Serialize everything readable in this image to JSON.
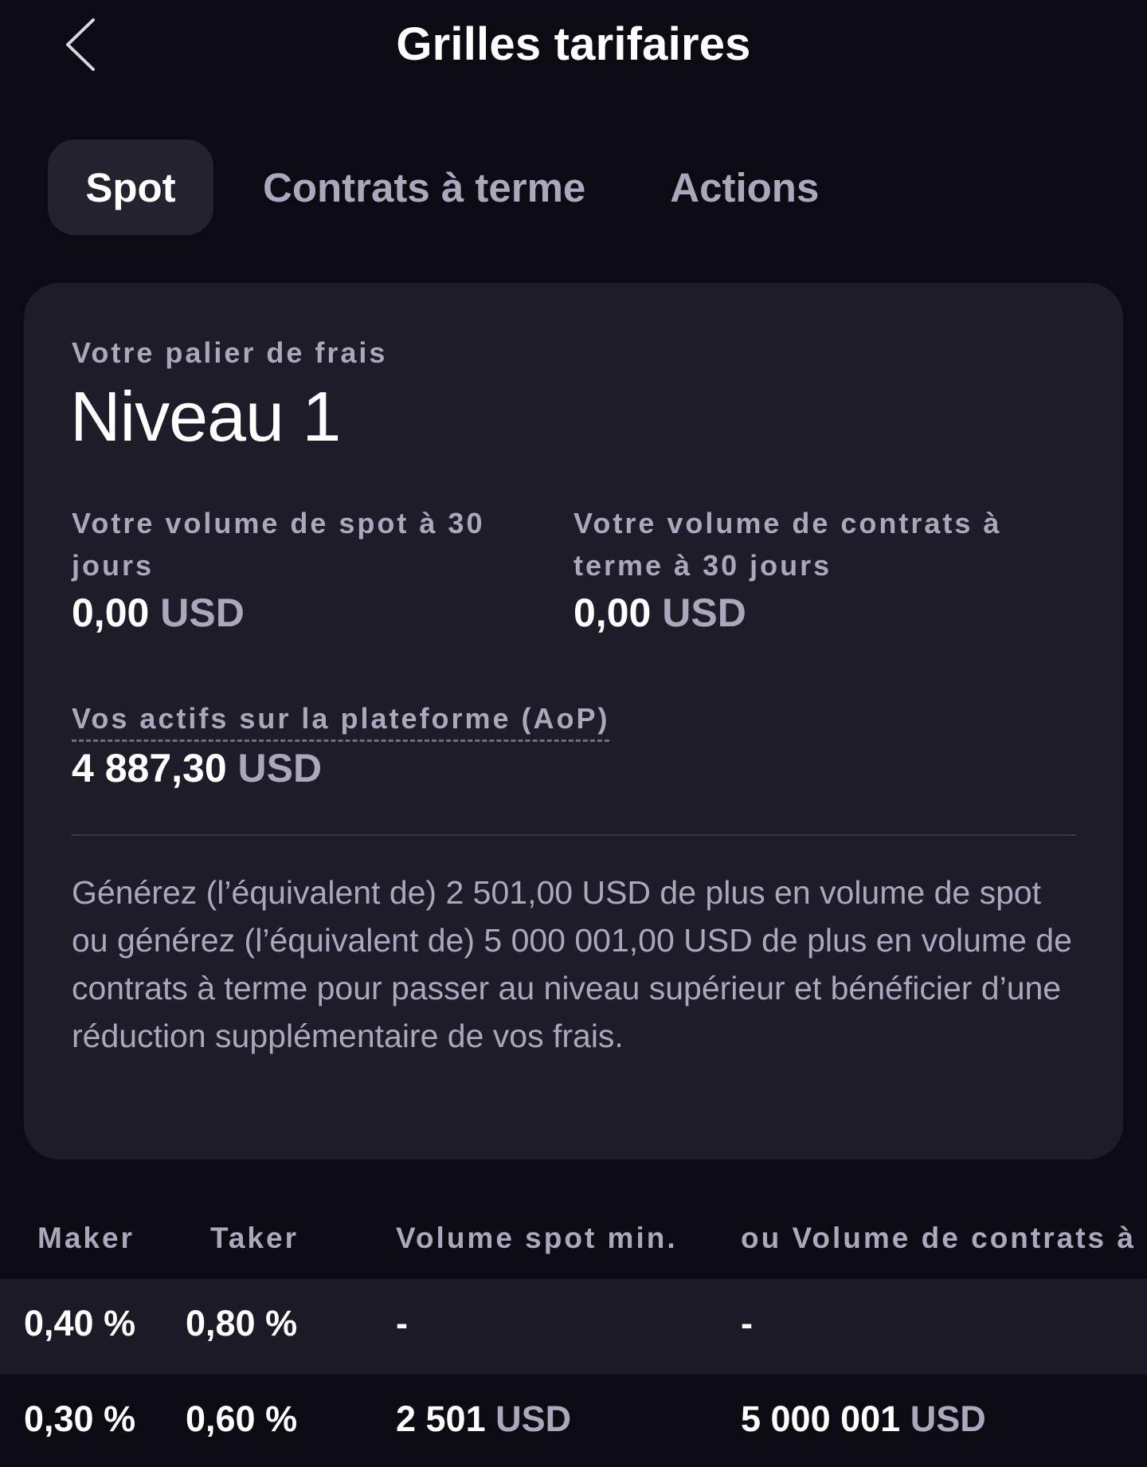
{
  "header": {
    "title": "Grilles tarifaires",
    "back_icon": "chevron-left-icon"
  },
  "tabs": [
    {
      "label": "Spot",
      "active": true
    },
    {
      "label": "Contrats à terme",
      "active": false
    },
    {
      "label": "Actions",
      "active": false
    }
  ],
  "card": {
    "tier_label": "Votre palier de frais",
    "tier_value": "Niveau 1",
    "spot_volume": {
      "label": "Votre volume de spot à 30 jours",
      "amount": "0,00",
      "unit": "USD"
    },
    "futures_volume": {
      "label": "Votre volume de contrats à terme à 30 jours",
      "amount": "0,00",
      "unit": "USD"
    },
    "aop": {
      "label": "Vos actifs sur la plateforme (AoP)",
      "amount": "4 887,30",
      "unit": "USD"
    },
    "description": "Générez (l’équivalent de) 2 501,00 USD de plus en volume de spot ou générez (l’équivalent de) 5 000 001,00 USD de plus en volume de contrats à terme pour passer au niveau supérieur et bénéficier d’une réduction supplémentaire de vos frais."
  },
  "table": {
    "headers": [
      "Maker",
      "Taker",
      "Volume spot min.",
      "ou Volume de contrats à"
    ],
    "rows": [
      {
        "maker": "0,40 %",
        "taker": "0,80 %",
        "spot_min": "-",
        "spot_unit": "",
        "futures_min": "-",
        "futures_unit": ""
      },
      {
        "maker": "0,30 %",
        "taker": "0,60 %",
        "spot_min": "2 501",
        "spot_unit": "USD",
        "futures_min": "5 000 001",
        "futures_unit": "USD"
      }
    ]
  },
  "colors": {
    "background": "#0c0a12",
    "card": "#1d1c28",
    "active_tab": "#23222e",
    "muted_text": "#a9a8bc",
    "primary_text": "#ffffff"
  }
}
